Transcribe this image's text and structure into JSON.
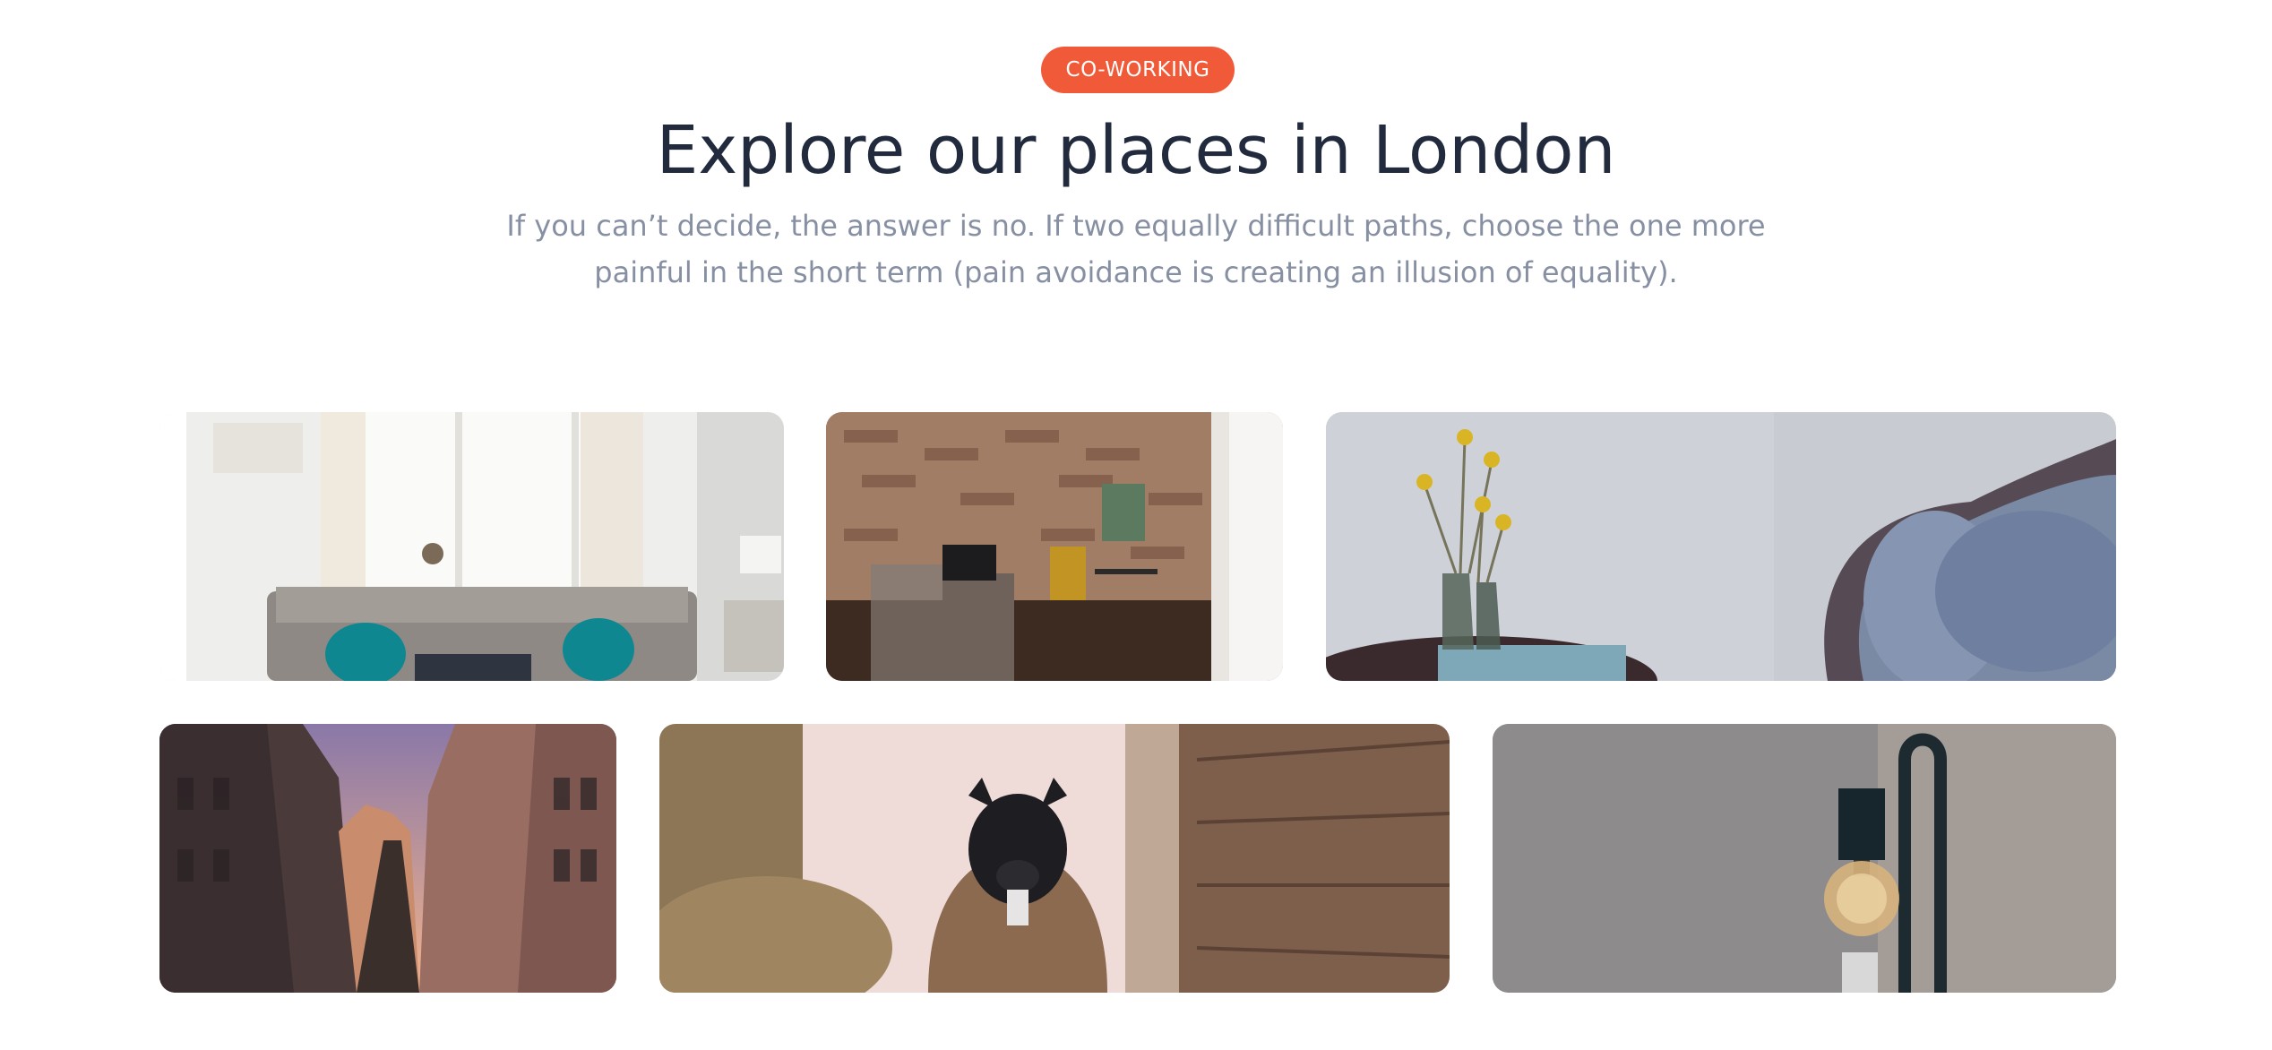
{
  "section": {
    "badge": "CO-WORKING",
    "title": "Explore our places in London",
    "description": "If you can’t decide, the answer is no. If two equally difficult paths, choose the one more painful in the short term (pain avoidance is creating an illusion of equality).",
    "accent_color": "#f05a38",
    "title_color": "#222b3e",
    "text_color": "#8790a3"
  },
  "gallery": {
    "images": [
      {
        "name": "living-room-sofa-photo"
      },
      {
        "name": "brick-wall-room-photo"
      },
      {
        "name": "vase-flowers-armchair-photo"
      },
      {
        "name": "city-street-photo"
      },
      {
        "name": "dog-in-jacket-photo"
      },
      {
        "name": "pendant-lamp-photo"
      }
    ]
  }
}
